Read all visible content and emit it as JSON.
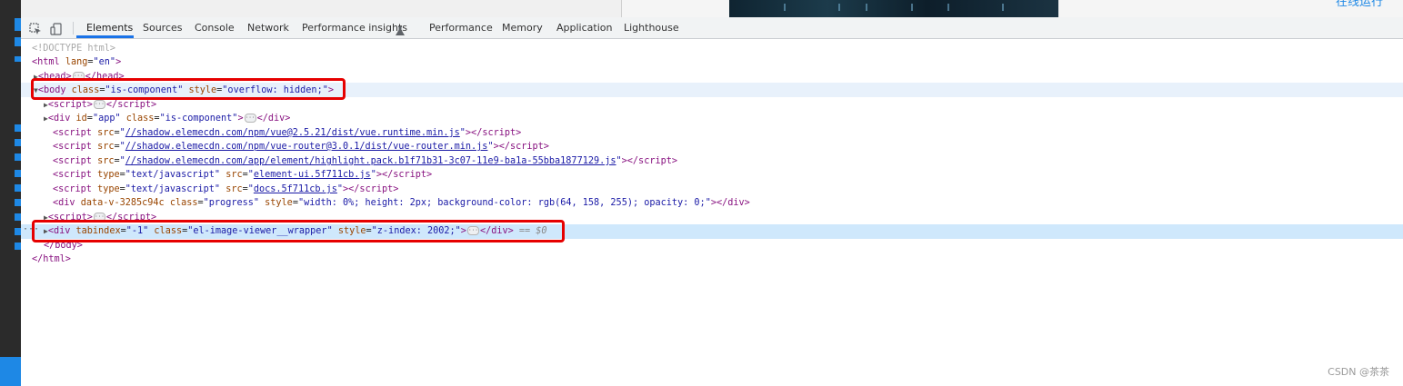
{
  "host": {
    "cut_link": "在线运行"
  },
  "toolbar": {
    "tabs": [
      {
        "label": "Elements"
      },
      {
        "label": "Sources"
      },
      {
        "label": "Console"
      },
      {
        "label": "Network"
      },
      {
        "label": "Performance insights"
      },
      {
        "label": "Performance"
      },
      {
        "label": "Memory"
      },
      {
        "label": "Application"
      },
      {
        "label": "Lighthouse"
      }
    ],
    "inspect_icon": "inspect-element-icon",
    "device_icon": "device-toolbar-icon",
    "flask_icon": "experiment-flask-icon"
  },
  "dom": {
    "doctype": "<!DOCTYPE html>",
    "html_tag": "html",
    "html_attr": "lang",
    "html_attr_val": "\"en\"",
    "head": "head",
    "body_tag": "body",
    "body_class_val": "\"is-component\"",
    "body_style_val": "\"overflow: hidden;\"",
    "script1": "script",
    "div_app_id_val": "\"app\"",
    "div_app_class_val": "\"is-component\"",
    "vue_src": "//shadow.elemecdn.com/npm/vue@2.5.21/dist/vue.runtime.min.js",
    "router_src": "//shadow.elemecdn.com/npm/vue-router@3.0.1/dist/vue-router.min.js",
    "highlight_src": "//shadow.elemecdn.com/app/element/highlight.pack.b1f71b31-3c07-11e9-ba1a-55bba1877129.js",
    "type_val": "\"text/javascript\"",
    "elementui_src": "element-ui.5f711cb.js",
    "docs_src": "docs.5f711cb.js",
    "progress_attr": "data-v-3285c94c",
    "progress_class_val": "\"progress\"",
    "progress_style_val": "\"width: 0%; height: 2px; background-color: rgb(64, 158, 255); opacity: 0;\"",
    "tabindex_val": "\"-1\"",
    "viewer_class_val": "\"el-image-viewer__wrapper\"",
    "viewer_style_val": "\"z-index: 2002;\"",
    "selected_marker": "== $0",
    "close_body": "</body>",
    "close_html": "</html>"
  },
  "watermark": "CSDN @茶茶",
  "colors": {
    "tag": "#881280",
    "attr": "#994500",
    "value": "#1a1aa6",
    "highlight_box": "#e60000",
    "active_tab": "#1a73e8"
  }
}
